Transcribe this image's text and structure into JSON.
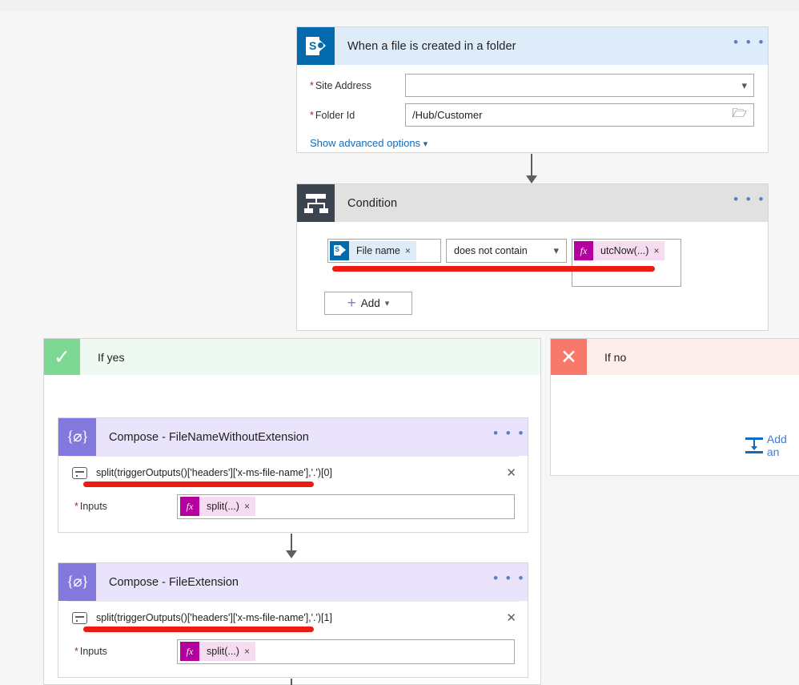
{
  "trigger": {
    "title": "When a file is created in a folder",
    "icon": "sharepoint-icon",
    "menu": "• • •",
    "fields": [
      {
        "label": "Site Address",
        "value": "",
        "required": true,
        "control": "dropdown"
      },
      {
        "label": "Folder Id",
        "value": "/Hub/Customer",
        "required": true,
        "control": "folder-picker"
      }
    ],
    "advanced_link": "Show advanced options"
  },
  "condition": {
    "title": "Condition",
    "icon": "condition-icon",
    "menu": "• • •",
    "left_token": {
      "label": "File name",
      "icon": "sharepoint-icon",
      "remove": "×"
    },
    "operator": "does not contain",
    "right_token": {
      "label": "utcNow(...)",
      "icon": "fx-icon",
      "remove": "×"
    },
    "add_button": "Add"
  },
  "branches": {
    "yes": {
      "label": "If yes",
      "icon": "check-icon",
      "glyph": "✓"
    },
    "no": {
      "label": "If no",
      "icon": "cross-icon",
      "glyph": "✕",
      "add_action": "Add an"
    }
  },
  "compose_actions": [
    {
      "title": "Compose - FileNameWithoutExtension",
      "icon": "compose-icon",
      "glyph": "{⌀}",
      "menu": "• • •",
      "expression": "split(triggerOutputs()['headers']['x-ms-file-name'],'.')[0]",
      "expression_remove": "✕",
      "inputs_label": "Inputs",
      "inputs_required": true,
      "inputs_token": {
        "label": "split(...)",
        "icon": "fx-icon",
        "remove": "×"
      }
    },
    {
      "title": "Compose - FileExtension",
      "icon": "compose-icon",
      "glyph": "{⌀}",
      "menu": "• • •",
      "expression": "split(triggerOutputs()['headers']['x-ms-file-name'],'.')[1]",
      "expression_remove": "✕",
      "inputs_label": "Inputs",
      "inputs_required": true,
      "inputs_token": {
        "label": "split(...)",
        "icon": "fx-icon",
        "remove": "×"
      }
    }
  ],
  "colors": {
    "sharepoint_blue": "#036ab0",
    "trigger_header": "#deecf9",
    "condition_header": "#e1e1e1",
    "condition_icon": "#3b444f",
    "compose_purple": "#8378de",
    "compose_header": "#e9e3fb",
    "yes_green": "#7dd894",
    "no_red": "#f7796b",
    "fx_magenta": "#b4009e",
    "annotation_red": "#ee1b11",
    "link_blue": "#0f6cbd",
    "page_bg": "#f6f6f6"
  }
}
